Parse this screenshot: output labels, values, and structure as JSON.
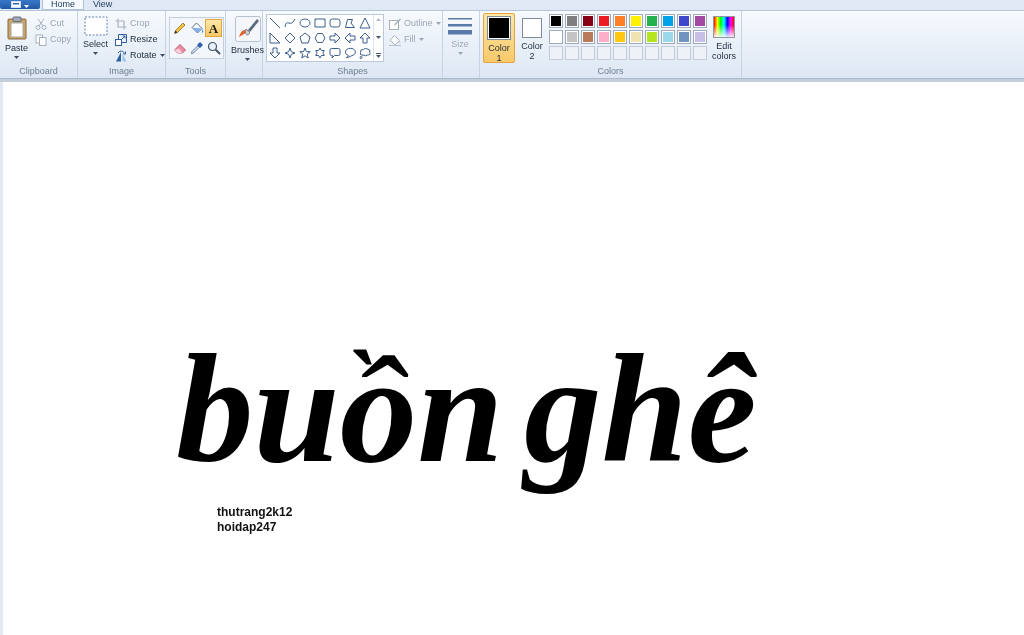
{
  "tabs": [
    {
      "label": "Home",
      "selected": true
    },
    {
      "label": "View",
      "selected": false
    }
  ],
  "clipboard": {
    "label": "Clipboard",
    "paste": "Paste",
    "actions": [
      {
        "kind": "cut",
        "label": "Cut",
        "disabled": true
      },
      {
        "kind": "copy",
        "label": "Copy",
        "disabled": true
      }
    ]
  },
  "image": {
    "label": "Image",
    "select": "Select",
    "actions": [
      {
        "kind": "crop",
        "label": "Crop",
        "disabled": true,
        "dropdown": false
      },
      {
        "kind": "resize",
        "label": "Resize",
        "disabled": false,
        "dropdown": false
      },
      {
        "kind": "rotate",
        "label": "Rotate",
        "disabled": false,
        "dropdown": true
      }
    ]
  },
  "tools": {
    "label": "Tools",
    "items": [
      {
        "kind": "pencil",
        "selected": false
      },
      {
        "kind": "fill",
        "selected": false
      },
      {
        "kind": "text",
        "glyph": "A",
        "selected": true
      },
      {
        "kind": "eraser",
        "selected": false
      },
      {
        "kind": "picker",
        "selected": false
      },
      {
        "kind": "magnifier",
        "selected": false
      }
    ]
  },
  "brushes": {
    "label": "Brushes"
  },
  "shapes": {
    "label": "Shapes",
    "options": [
      {
        "kind": "outline",
        "label": "Outline",
        "disabled": true
      },
      {
        "kind": "fill",
        "label": "Fill",
        "disabled": true
      }
    ]
  },
  "size": {
    "label": "Size",
    "disabled": true
  },
  "colors": {
    "label": "Colors",
    "slots": [
      {
        "label": "Color 1",
        "color": "#000000",
        "selected": true
      },
      {
        "label": "Color 2",
        "color": "#ffffff",
        "selected": false
      }
    ],
    "palette": [
      {
        "kind": "swatch",
        "color": "#000000"
      },
      {
        "kind": "swatch",
        "color": "#7f7f7f"
      },
      {
        "kind": "swatch",
        "color": "#880015"
      },
      {
        "kind": "swatch",
        "color": "#ed1c24"
      },
      {
        "kind": "swatch",
        "color": "#ff7f27"
      },
      {
        "kind": "swatch",
        "color": "#fff200"
      },
      {
        "kind": "swatch",
        "color": "#22b14c"
      },
      {
        "kind": "swatch",
        "color": "#00a2e8"
      },
      {
        "kind": "swatch",
        "color": "#3f48cc"
      },
      {
        "kind": "swatch",
        "color": "#a349a4"
      },
      {
        "kind": "swatch",
        "color": "#ffffff"
      },
      {
        "kind": "swatch",
        "color": "#c3c3c3"
      },
      {
        "kind": "swatch",
        "color": "#b97a57"
      },
      {
        "kind": "swatch",
        "color": "#ffaec9"
      },
      {
        "kind": "swatch",
        "color": "#ffc90e"
      },
      {
        "kind": "swatch",
        "color": "#efe4b0"
      },
      {
        "kind": "swatch",
        "color": "#b5e61d"
      },
      {
        "kind": "swatch",
        "color": "#99d9ea"
      },
      {
        "kind": "swatch",
        "color": "#7092be"
      },
      {
        "kind": "swatch",
        "color": "#c8bfe7"
      },
      {
        "kind": "empty"
      },
      {
        "kind": "empty"
      },
      {
        "kind": "empty"
      },
      {
        "kind": "empty"
      },
      {
        "kind": "empty"
      },
      {
        "kind": "empty"
      },
      {
        "kind": "empty"
      },
      {
        "kind": "empty"
      },
      {
        "kind": "empty"
      },
      {
        "kind": "empty"
      }
    ],
    "edit": "Edit colors"
  },
  "canvas": {
    "lettering": [
      "buồn",
      "ghê"
    ],
    "signature": [
      "thutrang2k12",
      "hoidap247"
    ]
  }
}
